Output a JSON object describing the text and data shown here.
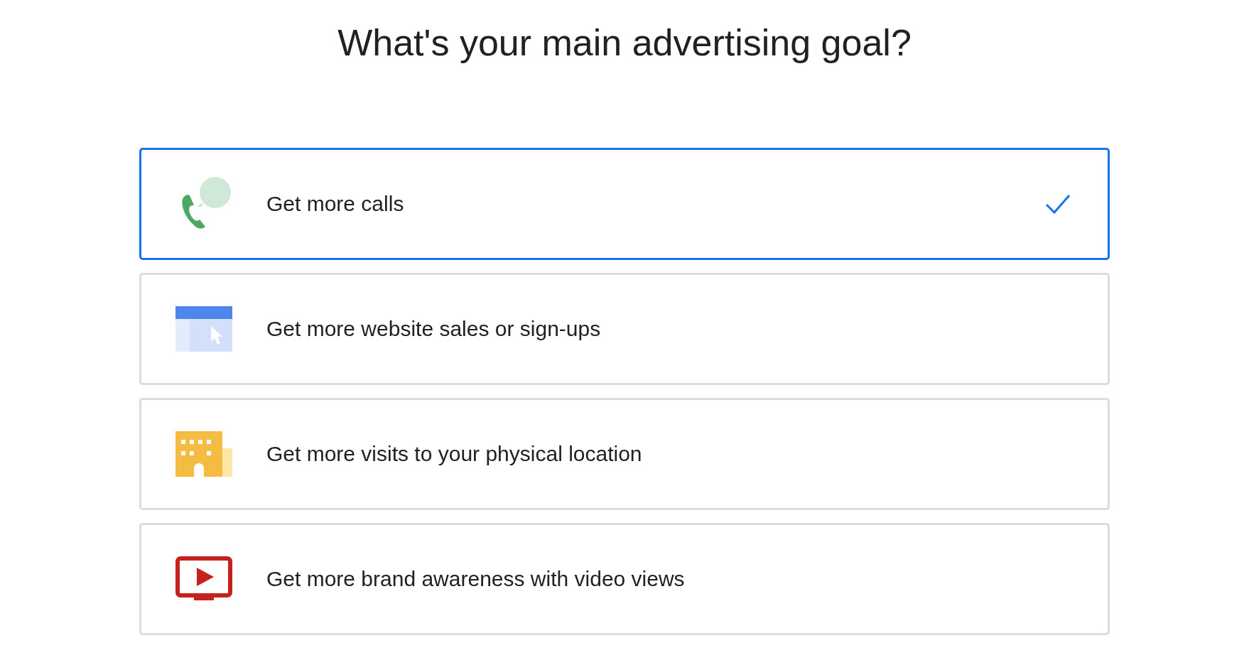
{
  "title": "What's your main advertising goal?",
  "options": [
    {
      "kind": "calls",
      "label": "Get more calls",
      "selected": true
    },
    {
      "kind": "website",
      "label": "Get more website sales or sign-ups",
      "selected": false
    },
    {
      "kind": "visits",
      "label": "Get more visits to your physical location",
      "selected": false
    },
    {
      "kind": "video",
      "label": "Get more brand awareness with video views",
      "selected": false
    }
  ]
}
